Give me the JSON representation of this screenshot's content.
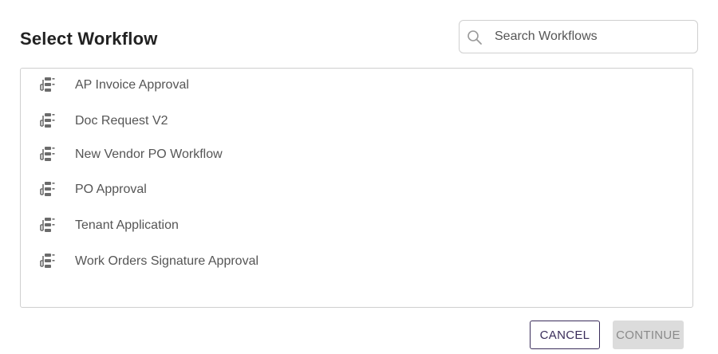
{
  "dialog": {
    "title": "Select Workflow",
    "search": {
      "placeholder": "Search Workflows",
      "value": ""
    },
    "workflows": [
      {
        "label": "AP Invoice Approval",
        "icon": "workflow-icon"
      },
      {
        "label": "Doc Request V2",
        "icon": "workflow-icon"
      },
      {
        "label": "New Vendor PO Workflow",
        "icon": "workflow-icon"
      },
      {
        "label": "PO Approval",
        "icon": "workflow-icon"
      },
      {
        "label": "Tenant Application",
        "icon": "workflow-icon"
      },
      {
        "label": "Work Orders Signature Approval",
        "icon": "workflow-icon"
      }
    ],
    "buttons": {
      "cancel": "CANCEL",
      "continue": "CONTINUE"
    }
  },
  "colors": {
    "title": "#222222",
    "item_text": "#555555",
    "icon": "#6b6b6b",
    "border": "#cfcfcf",
    "cancel_border": "#3a2d5a",
    "continue_bg": "#dcdcdc",
    "continue_text": "#8a8a8a"
  }
}
